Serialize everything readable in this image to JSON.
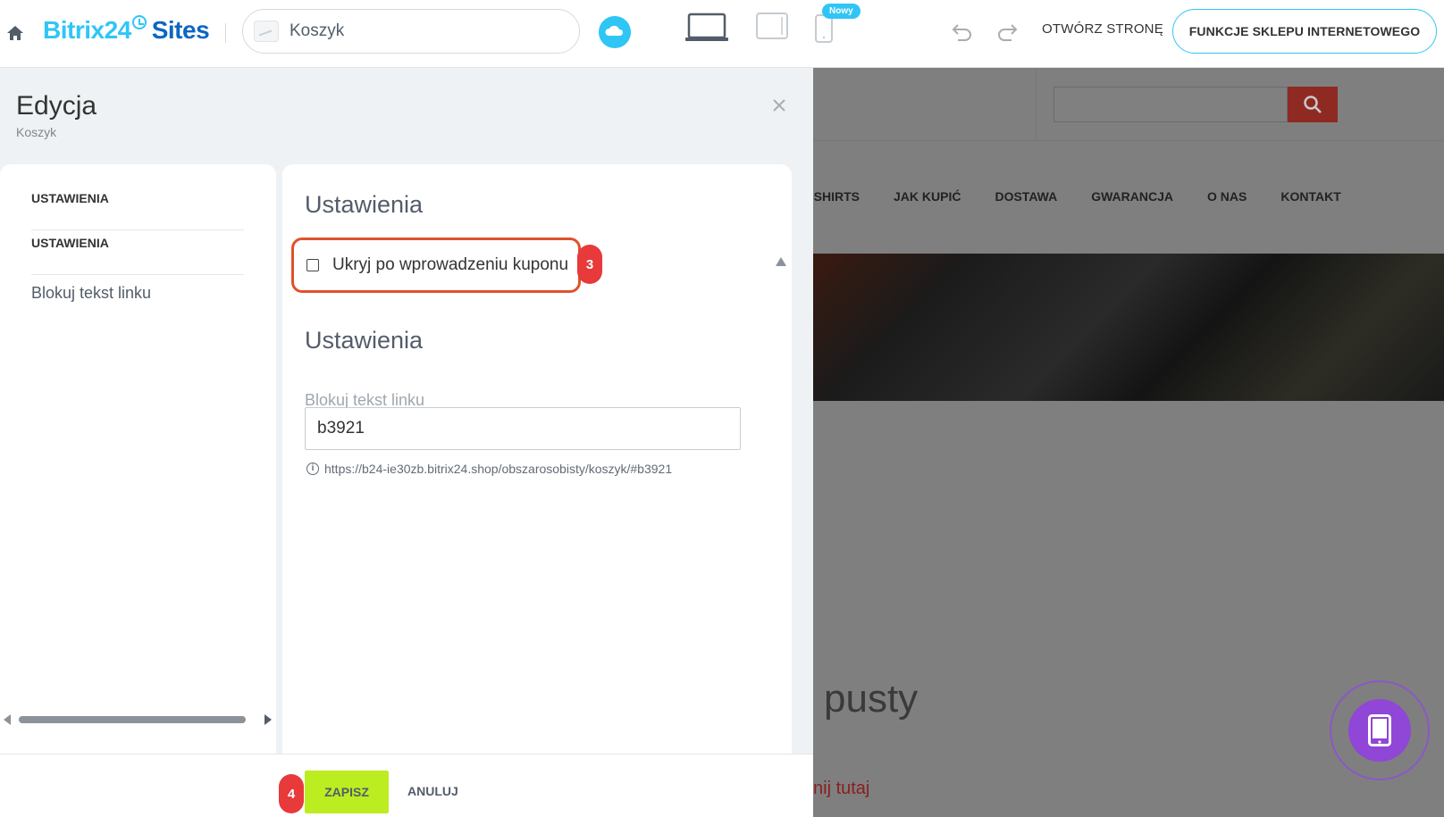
{
  "topbar": {
    "logo_text": "Bitrix24",
    "logo_sites": "Sites",
    "page_name": "Koszyk",
    "new_badge": "Nowy",
    "open_page_label": "OTWÓRZ STRONĘ",
    "shop_features_label": "FUNKCJE SKLEPU INTERNETOWEGO",
    "icons": [
      "home-icon",
      "cloud-icon",
      "desktop-icon",
      "tablet-icon",
      "phone-icon",
      "undo-icon",
      "redo-icon"
    ]
  },
  "editor": {
    "title": "Edycja",
    "subtitle": "Koszyk",
    "nav": [
      {
        "label": "USTAWIENIA"
      },
      {
        "label": "USTAWIENIA"
      },
      {
        "label": "Blokuj tekst linku"
      }
    ],
    "section1_title": "Ustawienia",
    "checkbox_label": "Ukryj po wprowadzeniu kuponu",
    "checkbox_checked": false,
    "section2_title": "Ustawienia",
    "field_label": "Blokuj tekst linku",
    "field_value": "b3921",
    "field_hint": "https://b24-ie30zb.bitrix24.shop/obszarosobisty/koszyk/#b3921",
    "save_label": "ZAPISZ",
    "cancel_label": "ANULUJ"
  },
  "steps": {
    "step3": "3",
    "step4": "4"
  },
  "preview": {
    "nav": [
      "-SHIRTS",
      "JAK KUPIĆ",
      "DOSTAWA",
      "GWARANCJA",
      "O NAS",
      "KONTAKT"
    ],
    "empty_title": "pusty",
    "link_text": "nij tutaj"
  },
  "colors": {
    "accent": "#2fc6f6",
    "brand_dark": "#0b66c3",
    "highlight": "#e0512b",
    "step_badge": "#e8393b",
    "save_button": "#bbed21",
    "fab": "#9046d6"
  }
}
